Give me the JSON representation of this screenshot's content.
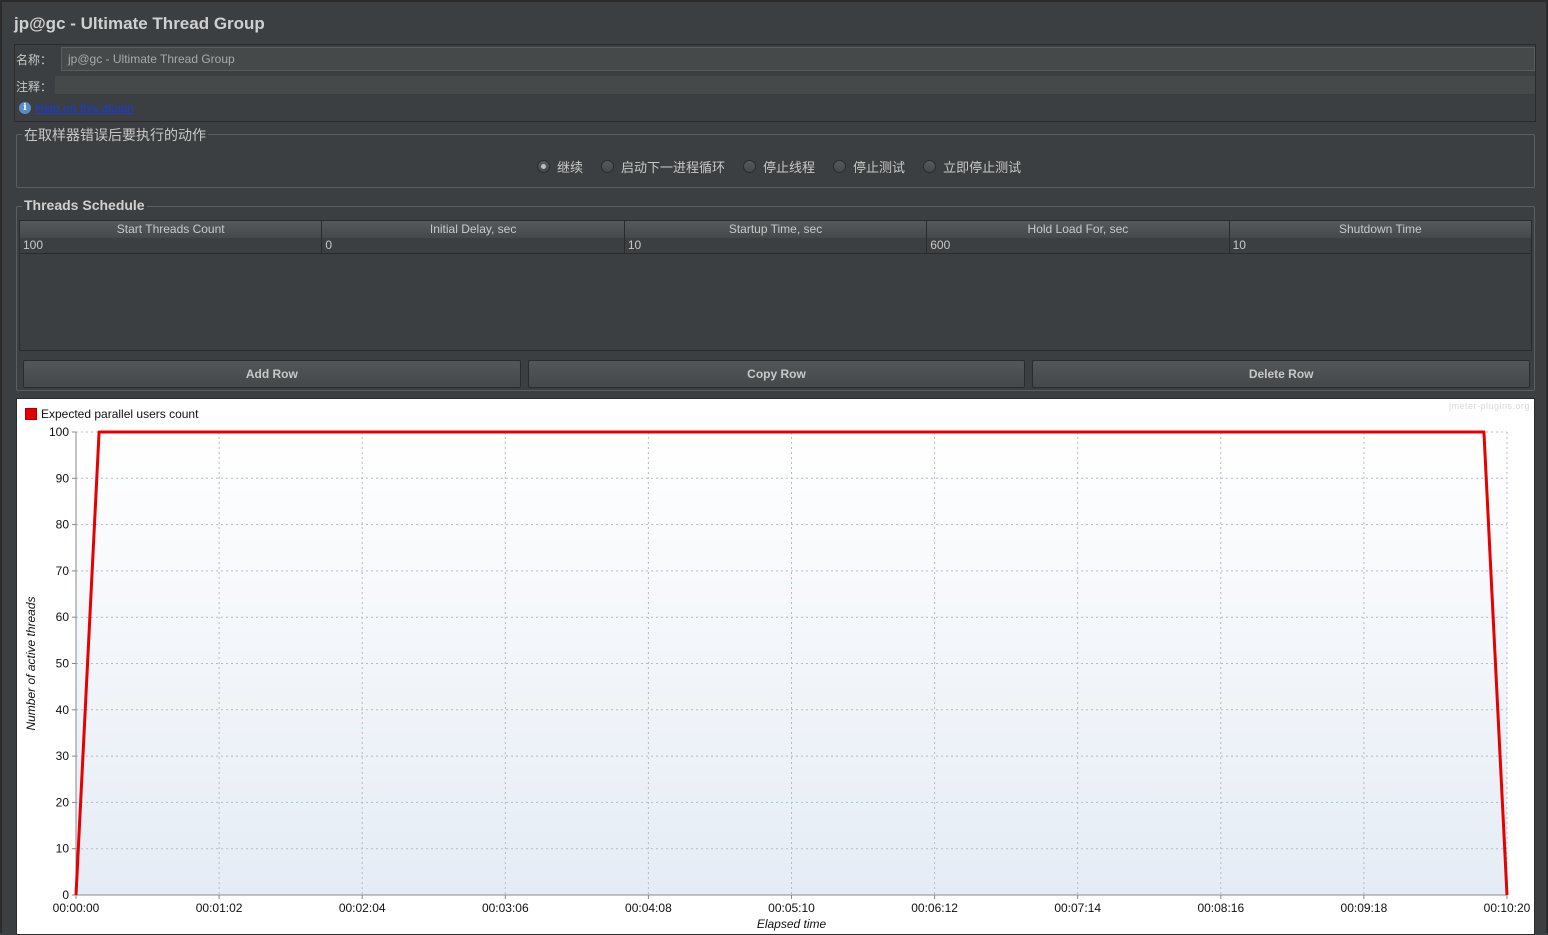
{
  "window": {
    "title": "jp@gc - Ultimate Thread Group"
  },
  "name_panel": {
    "name_label": "名称：",
    "name_value": "jp@gc - Ultimate Thread Group",
    "comment_label": "注释：",
    "comment_value": "",
    "help_link": "Help on this plugin",
    "info_icon": "info-icon"
  },
  "error_action": {
    "legend": "在取样器错误后要执行的动作",
    "options": [
      {
        "label": "继续",
        "selected": true
      },
      {
        "label": "启动下一进程循环",
        "selected": false
      },
      {
        "label": "停止线程",
        "selected": false
      },
      {
        "label": "停止测试",
        "selected": false
      },
      {
        "label": "立即停止测试",
        "selected": false
      }
    ]
  },
  "schedule": {
    "legend": "Threads Schedule",
    "columns": [
      "Start Threads Count",
      "Initial Delay, sec",
      "Startup Time, sec",
      "Hold Load For, sec",
      "Shutdown Time"
    ],
    "rows": [
      [
        "100",
        "0",
        "10",
        "600",
        "10"
      ]
    ],
    "buttons": {
      "add": "Add Row",
      "copy": "Copy Row",
      "delete": "Delete Row"
    }
  },
  "chart": {
    "watermark": "jmeter-plugins.org",
    "legend_label": "Expected parallel users count",
    "series_color": "#e60000"
  },
  "chart_data": {
    "type": "line",
    "title": "",
    "xlabel": "Elapsed time",
    "ylabel": "Number of active threads",
    "x_ticks": [
      "00:00:00",
      "00:01:02",
      "00:02:04",
      "00:03:06",
      "00:04:08",
      "00:05:10",
      "00:06:12",
      "00:07:14",
      "00:08:16",
      "00:09:18",
      "00:10:20"
    ],
    "y_ticks": [
      0,
      10,
      20,
      30,
      40,
      50,
      60,
      70,
      80,
      90,
      100
    ],
    "xlim_seconds": [
      0,
      620
    ],
    "ylim": [
      0,
      100
    ],
    "grid": true,
    "legend_position": "top-left",
    "series": [
      {
        "name": "Expected parallel users count",
        "x_seconds": [
          0,
          10,
          610,
          620
        ],
        "values": [
          0,
          100,
          100,
          0
        ]
      }
    ]
  }
}
